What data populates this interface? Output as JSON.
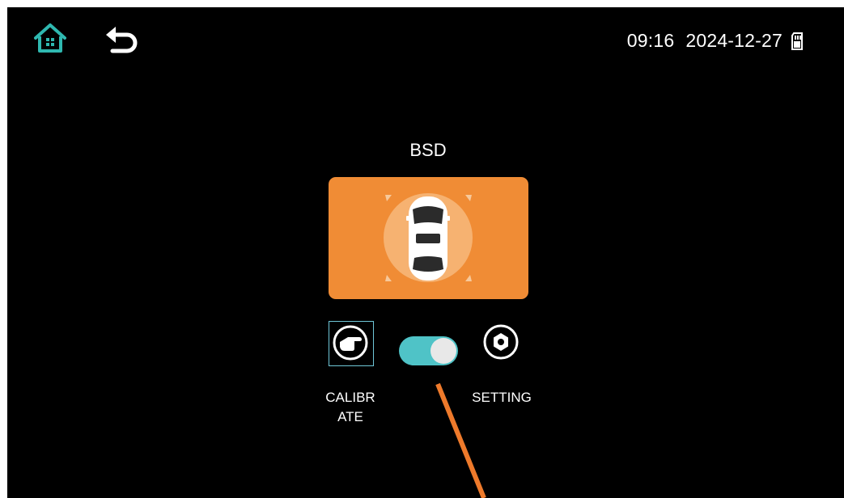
{
  "status_bar": {
    "time": "09:16",
    "date": "2024-12-27",
    "storage_icon": "sd-card-icon"
  },
  "nav": {
    "home_icon": "home-icon",
    "back_icon": "back-arrow-icon"
  },
  "main": {
    "title": "BSD",
    "card_icon": "car-top-view-icon",
    "calibrate_label": "CALIBRATE",
    "calibrate_icon": "pointing-hand-icon",
    "toggle_state": "on",
    "setting_label": "SETTING",
    "setting_icon": "nut-icon"
  },
  "colors": {
    "background": "#000000",
    "accent_teal": "#4fc3c7",
    "card_orange": "#f08c35",
    "annotation_orange": "#ee7a2b"
  }
}
